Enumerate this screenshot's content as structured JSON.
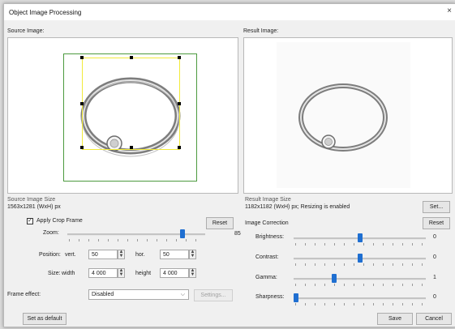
{
  "window": {
    "title": "Object Image Processing",
    "close_symbol": "×"
  },
  "source": {
    "label": "Source Image:",
    "size_title": "Source Image Size",
    "size_value": "1563x1281 (WxH) px"
  },
  "result": {
    "label": "Result Image:",
    "size_title": "Result Image Size",
    "size_value": "1182x1182 (WxH) px; Resizing is enabled",
    "set_label": "Set..."
  },
  "crop": {
    "checkbox_label": "Apply Crop Frame",
    "checked": true,
    "check_mark": "✓",
    "reset_label": "Reset",
    "zoom_label": "Zoom:",
    "zoom_value": "85",
    "zoom_level": 0.85,
    "position_label": "Position:",
    "vert_label": "vert.",
    "vert_value": "50",
    "hor_label": "hor.",
    "hor_value": "50",
    "size_label": "Size:",
    "width_label": "width",
    "width_value": "4 000",
    "height_label": "height",
    "height_value": "4 000",
    "frame_effect_label": "Frame effect:",
    "frame_effect_value": "Disabled",
    "settings_label": "Settings..."
  },
  "correction": {
    "title": "Image Correction",
    "reset_label": "Reset",
    "sliders": [
      {
        "label": "Brightness:",
        "value": "0",
        "level": 0.5
      },
      {
        "label": "Contrast:",
        "value": "0",
        "level": 0.5
      },
      {
        "label": "Gamma:",
        "value": "1",
        "level": 0.3
      },
      {
        "label": "Sharpness:",
        "value": "0",
        "level": 0.0
      }
    ]
  },
  "footer": {
    "default_label": "Set as default",
    "save_label": "Save",
    "cancel_label": "Cancel"
  },
  "colors": {
    "accent": "#1f6fd1",
    "crop_frame": "#f2ea3a",
    "source_border": "#4c9a3f"
  }
}
